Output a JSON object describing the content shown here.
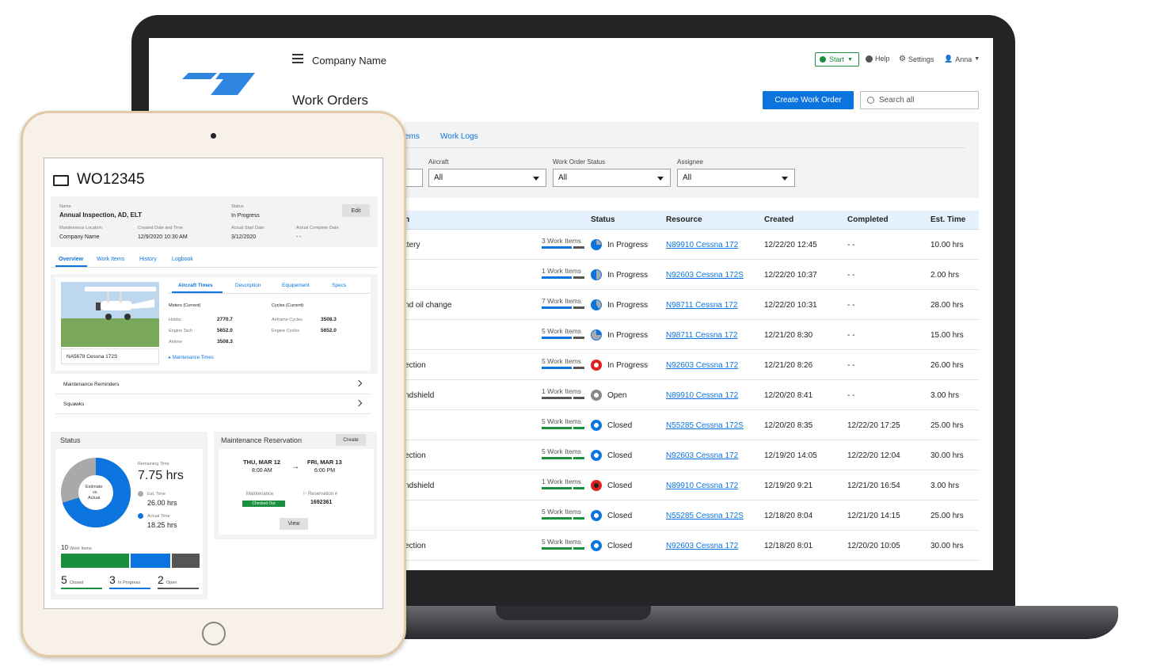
{
  "app": {
    "company_name": "Company Name",
    "page_title": "Work Orders",
    "start_label": "Start",
    "help_label": "Help",
    "settings_label": "Settings",
    "user_label": "Anna",
    "create_button": "Create Work Order",
    "search_placeholder": "Search all",
    "accent_color": "#0b74de",
    "success_color": "#1a8f3c"
  },
  "tabs": [
    "ems",
    "Work Logs"
  ],
  "filters": {
    "aircraft": {
      "label": "Aircraft",
      "value": "All"
    },
    "status": {
      "label": "Work Order Status",
      "value": "All"
    },
    "assignee": {
      "label": "Assignee",
      "value": "All"
    }
  },
  "table": {
    "headers": {
      "name": "n",
      "status": "Status",
      "resource": "Resource",
      "created": "Created",
      "completed": "Completed",
      "est": "Est. Time"
    },
    "rows": [
      {
        "name": "ttery",
        "work_items": "3 Work Items",
        "status": "In Progress",
        "icon": "progress-75",
        "resource": "N89910 Cessna 172",
        "created": "12/22/20 12:45",
        "completed": "- -",
        "est": "10.00 hrs"
      },
      {
        "name": "",
        "work_items": "1 Work Items",
        "status": "In Progress",
        "icon": "progress-50",
        "resource": "N92603 Cessna 172S",
        "created": "12/22/20 10:37",
        "completed": "- -",
        "est": "2.00 hrs"
      },
      {
        "name": "nd oil change",
        "work_items": "7 Work Items",
        "status": "In Progress",
        "icon": "progress-60",
        "resource": "N98711 Cessna 172",
        "created": "12/22/20 10:31",
        "completed": "- -",
        "est": "28.00 hrs"
      },
      {
        "name": "",
        "work_items": "5 Work Items",
        "status": "In Progress",
        "icon": "progress-25",
        "resource": "N98711 Cessna 172",
        "created": "12/21/20 8:30",
        "completed": "- -",
        "est": "15.00 hrs"
      },
      {
        "name": "ection",
        "work_items": "5 Work Items",
        "status": "In Progress",
        "icon": "overdue-red",
        "resource": "N92603 Cessna 172",
        "created": "12/21/20 8:26",
        "completed": "- -",
        "est": "26.00 hrs"
      },
      {
        "name": "ndshield",
        "work_items": "1 Work Items",
        "status": "Open",
        "icon": "open-gray",
        "resource": "N89910 Cessna 172",
        "created": "12/20/20 8:41",
        "completed": "- -",
        "est": "3.00 hrs"
      },
      {
        "name": "",
        "work_items": "5 Work Items",
        "status": "Closed",
        "icon": "closed-blue",
        "resource": "N55285 Cessna 172S",
        "created": "12/20/20 8:35",
        "completed": "12/22/20 17:25",
        "est": "25.00 hrs"
      },
      {
        "name": "ection",
        "work_items": "5 Work Items",
        "status": "Closed",
        "icon": "closed-blue",
        "resource": "N92603 Cessna 172",
        "created": "12/19/20 14:05",
        "completed": "12/22/20 12:04",
        "est": "30.00 hrs"
      },
      {
        "name": "ndshield",
        "work_items": "1 Work Items",
        "status": "Closed",
        "icon": "closed-red",
        "resource": "N89910 Cessna 172",
        "created": "12/19/20 9:21",
        "completed": "12/21/20 16:54",
        "est": "3.00 hrs"
      },
      {
        "name": "",
        "work_items": "5 Work Items",
        "status": "Closed",
        "icon": "closed-blue",
        "resource": "N55285 Cessna 172S",
        "created": "12/18/20 8:04",
        "completed": "12/21/20 14:15",
        "est": "25.00 hrs"
      },
      {
        "name": "ection",
        "work_items": "5 Work Items",
        "status": "Closed",
        "icon": "closed-blue",
        "resource": "N92603 Cessna 172",
        "created": "12/18/20 8:01",
        "completed": "12/20/20 10:05",
        "est": "30.00 hrs"
      }
    ]
  },
  "tablet": {
    "wo_number": "WO12345",
    "name_label": "Name",
    "name": "Annual Inspection, AD, ELT",
    "status_label": "Status",
    "status": "In Progress",
    "edit_label": "Edit",
    "loc_label": "Maintenance Location",
    "loc": "Company Name",
    "created_label": "Created Date and Time",
    "created": "12/9/2020 10:30 AM",
    "start_label": "Actual Start Date",
    "start": "3/12/2020",
    "complete_label": "Actual Complete Date",
    "complete": "- -",
    "tabs": [
      "Overview",
      "Work Items",
      "History",
      "Logbook"
    ],
    "subtabs": [
      "Aircraft Times",
      "Description",
      "Equipement",
      "Specs"
    ],
    "aircraft_caption": "NA5678 Cessna 172S",
    "meters_title": "Meters (Current)",
    "cycles_title": "Cycles (Current)",
    "meters": [
      {
        "label": "Hobbs",
        "value": "2770.7"
      },
      {
        "label": "Engine Tach",
        "value": "5652.0"
      },
      {
        "label": "Airtime",
        "value": "3508.3"
      }
    ],
    "cycles": [
      {
        "label": "Airframe Cycles",
        "value": "3508.3"
      },
      {
        "label": "Engine Cycles",
        "value": "5652.0"
      }
    ],
    "maint_times_link": "Maintenance Times",
    "list": [
      "Maintenance Reminders",
      "Squawks"
    ],
    "status_card": {
      "title": "Status",
      "donut_label1": "Estimate",
      "donut_label2": "vs.",
      "donut_label3": "Actual",
      "remaining_label": "Remaining Time",
      "remaining": "7.75 hrs",
      "est_label": "Est. Time",
      "est": "26.00 hrs",
      "actual_label": "Actual Time",
      "actual": "18.25 hrs",
      "actual_fraction": 0.702,
      "total": "10",
      "total_label": "Work Items",
      "closed": "5",
      "closed_label": "Closed",
      "inprogress": "3",
      "inprogress_label": "In Progress",
      "open": "2",
      "open_label": "Open"
    },
    "reservation": {
      "title": "Maintenance Reservation",
      "create_label": "Create",
      "start_day": "THU, MAR 12",
      "start_time": "8:00 AM",
      "end_day": "FRI, MAR 13",
      "end_time": "6:00 PM",
      "maint_label": "Maintenance",
      "maint_status": "Checked Out",
      "res_label": "Reservation #",
      "res_number": "1692361",
      "view_label": "View"
    }
  }
}
